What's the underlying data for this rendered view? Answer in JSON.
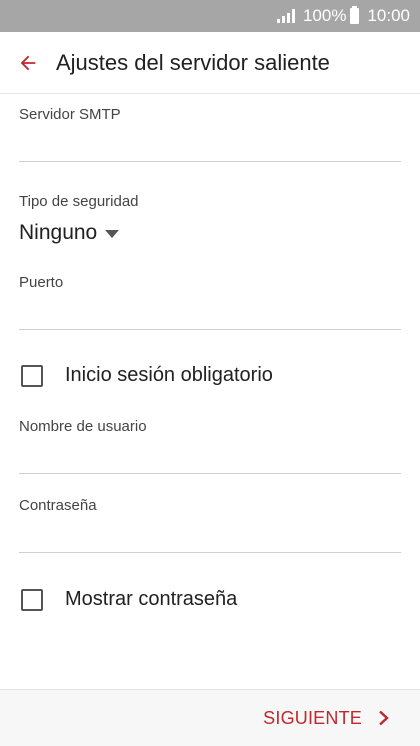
{
  "status_bar": {
    "battery_percent": "100%",
    "time": "10:00"
  },
  "app_bar": {
    "title": "Ajustes del servidor saliente"
  },
  "form": {
    "smtp_server": {
      "label": "Servidor SMTP",
      "value": ""
    },
    "security_type": {
      "label": "Tipo de seguridad",
      "value": "Ninguno"
    },
    "port": {
      "label": "Puerto",
      "value": ""
    },
    "login_required": {
      "label": "Inicio sesión obligatorio",
      "checked": false
    },
    "username": {
      "label": "Nombre de usuario",
      "value": ""
    },
    "password": {
      "label": "Contraseña",
      "value": ""
    },
    "show_password": {
      "label": "Mostrar contraseña",
      "checked": false
    }
  },
  "bottom_bar": {
    "next_label": "SIGUIENTE"
  },
  "colors": {
    "accent": "#c0282e",
    "status_bar": "#a6a6a6"
  },
  "icons": {
    "back": "arrow-left-icon",
    "next": "chevron-right-icon",
    "signal": "signal-icon",
    "battery": "battery-icon"
  }
}
